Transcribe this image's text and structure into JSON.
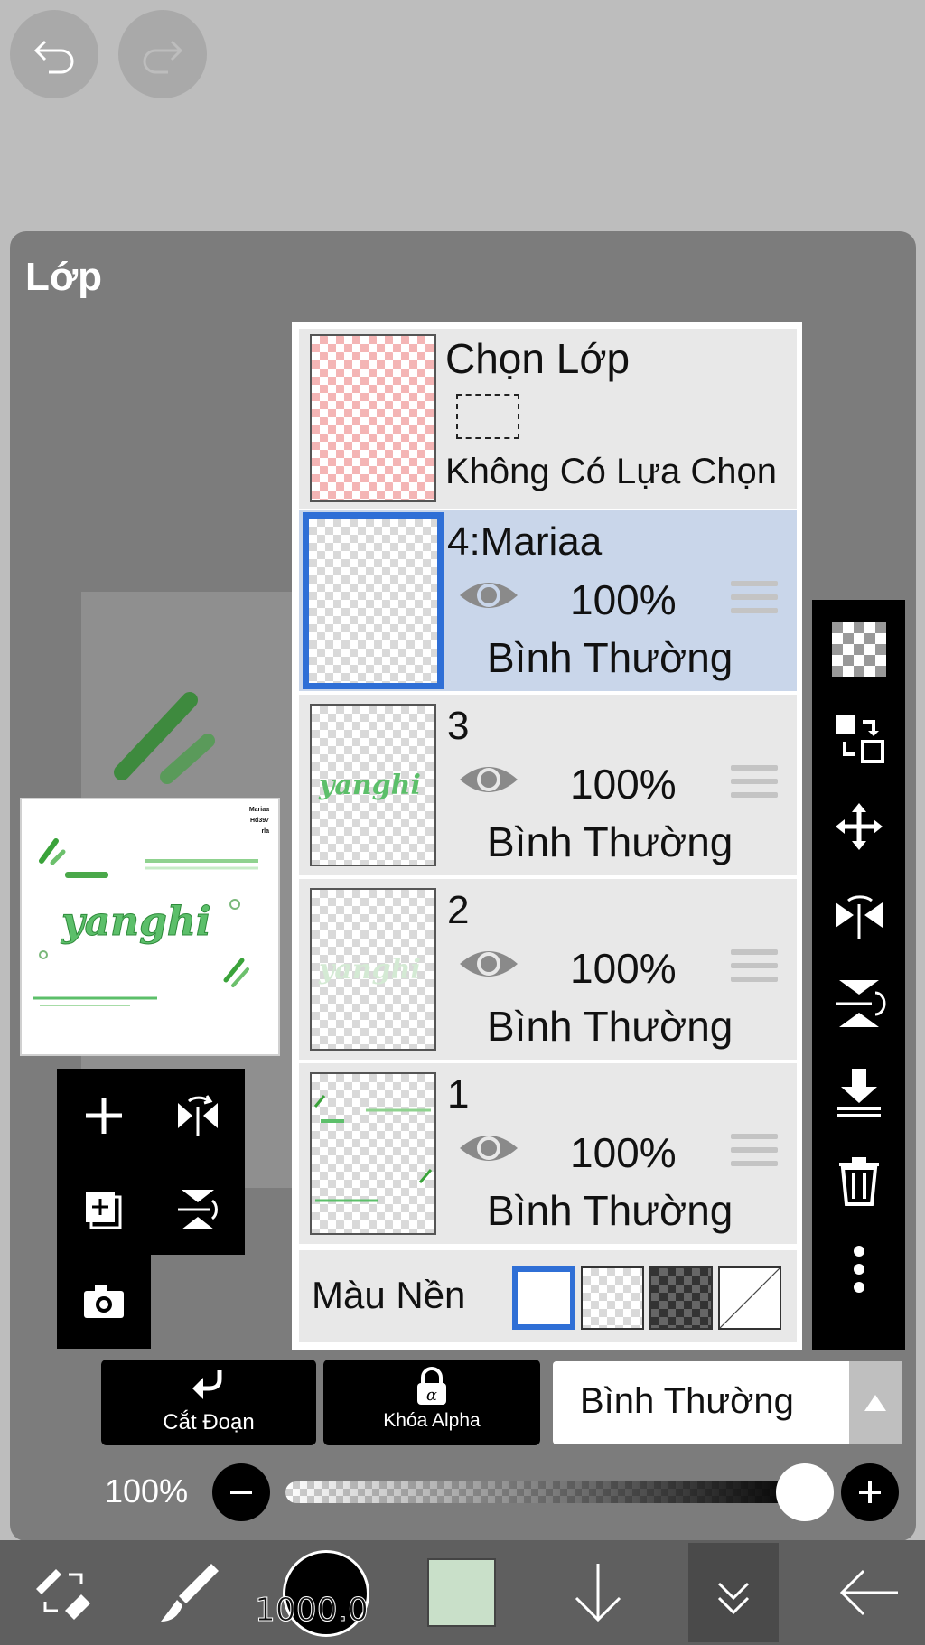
{
  "top": {
    "undo_icon": "undo-icon",
    "redo_icon": "redo-icon"
  },
  "panel": {
    "title": "Lớp"
  },
  "preview": {
    "text_lines": [
      "Mariaa",
      "Hd397",
      "rla"
    ]
  },
  "selection_layer": {
    "title": "Chọn Lớp",
    "subtitle": "Không Có Lựa Chọn"
  },
  "layers": [
    {
      "name": "4:Mariaa",
      "opacity": "100%",
      "blend": "Bình Thường",
      "active": true
    },
    {
      "name": "3",
      "opacity": "100%",
      "blend": "Bình Thường",
      "active": false
    },
    {
      "name": "2",
      "opacity": "100%",
      "blend": "Bình Thường",
      "active": false
    },
    {
      "name": "1",
      "opacity": "100%",
      "blend": "Bình Thường",
      "active": false
    }
  ],
  "background": {
    "label": "Màu Nền",
    "options": [
      "white",
      "light-checker",
      "dark-checker",
      "none"
    ],
    "selected": "white"
  },
  "right_tools": [
    "checker-icon",
    "swap-layers-icon",
    "move-icon",
    "flip-horizontal-icon",
    "flip-vertical-icon",
    "merge-down-icon",
    "trash-icon",
    "more-vertical-icon"
  ],
  "left_tools": [
    "add-layer-icon",
    "flip-icon",
    "add-copy-layer-icon",
    "flip-vertical-icon",
    "camera-icon"
  ],
  "actions": {
    "clip_label": "Cắt Đoạn",
    "alpha_lock_label": "Khóa Alpha",
    "blend_mode": "Bình Thường"
  },
  "opacity": {
    "label": "100%",
    "value": 1.0
  },
  "bottom_bar": {
    "brush_size": "1000.0",
    "color": "#c9e0c9"
  }
}
